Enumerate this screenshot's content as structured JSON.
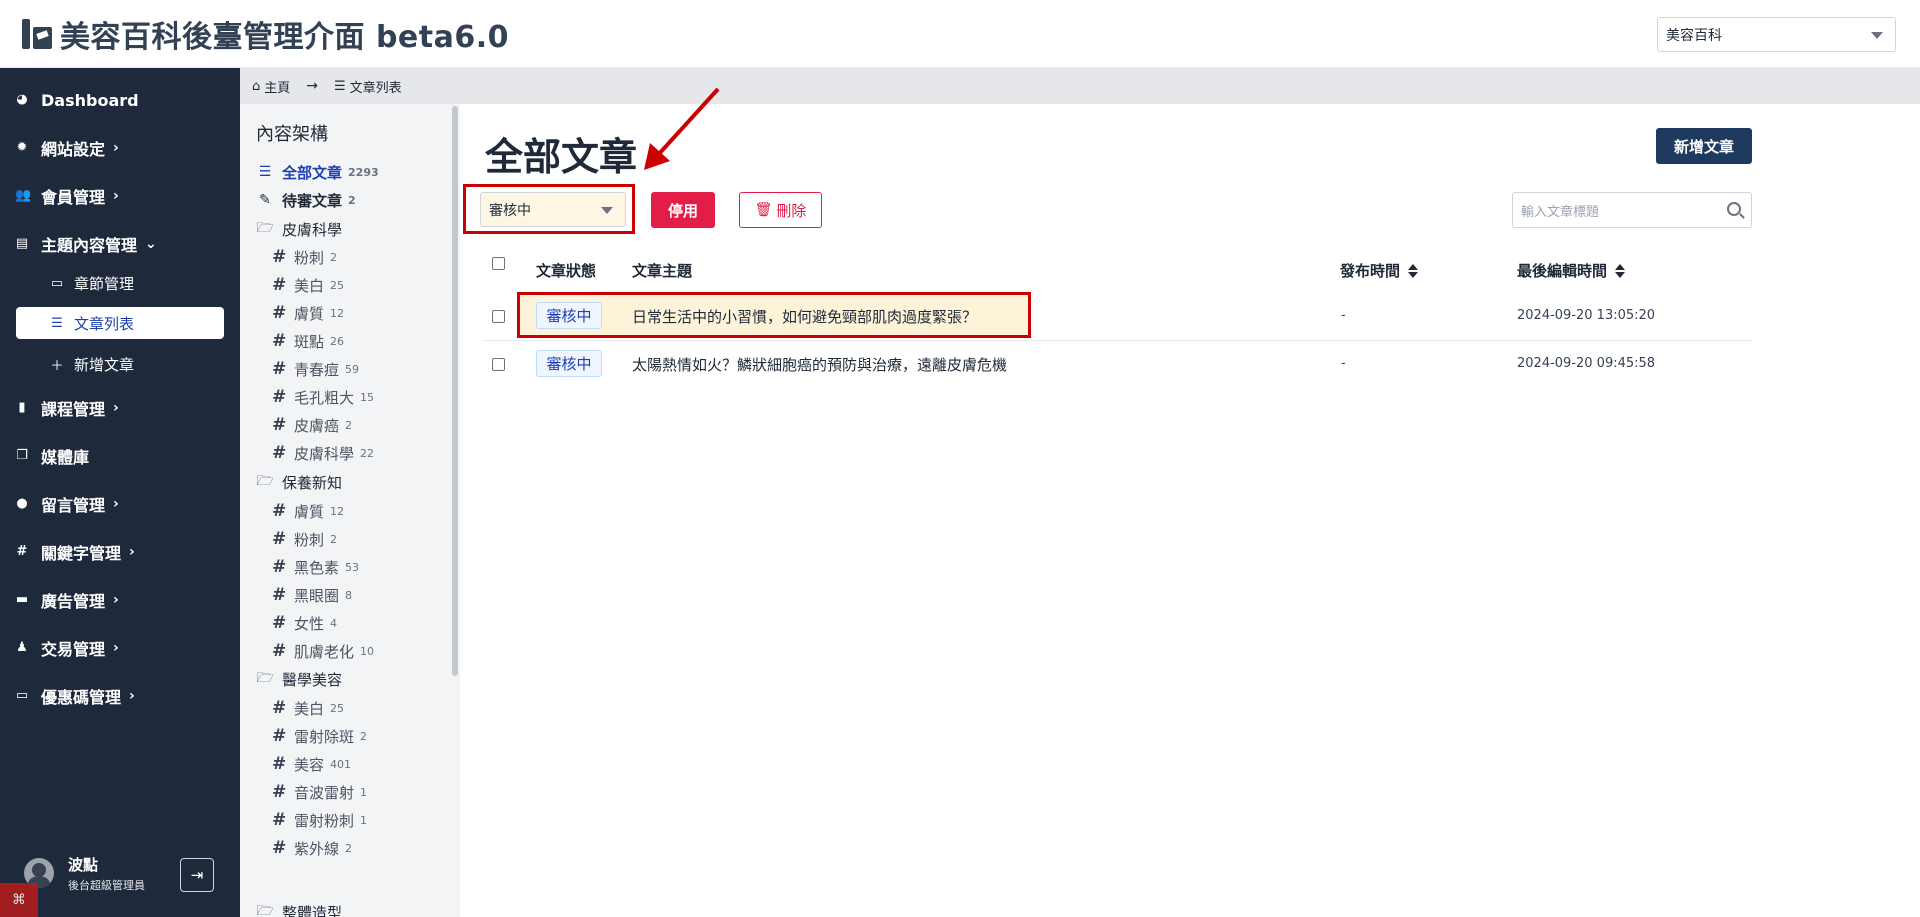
{
  "header": {
    "title": "美容百科後臺管理介面 beta6.0",
    "site_select": "美容百科"
  },
  "sidebar": {
    "items": [
      {
        "label": "Dashboard",
        "icon": "dashboard-icon",
        "chevron": ""
      },
      {
        "label": "網站設定",
        "icon": "gear-icon",
        "chevron": "›"
      },
      {
        "label": "會員管理",
        "icon": "users-icon",
        "chevron": "›"
      },
      {
        "label": "主題內容管理",
        "icon": "layout-icon",
        "chevron": "⌄"
      },
      {
        "label": "課程管理",
        "icon": "book-icon",
        "chevron": "›"
      },
      {
        "label": "媒體庫",
        "icon": "images-icon",
        "chevron": ""
      },
      {
        "label": "留言管理",
        "icon": "comment-icon",
        "chevron": "›"
      },
      {
        "label": "關鍵字管理",
        "icon": "hash-icon",
        "chevron": "›"
      },
      {
        "label": "廣告管理",
        "icon": "ad-icon",
        "chevron": "›"
      },
      {
        "label": "交易管理",
        "icon": "money-bag-icon",
        "chevron": "›"
      },
      {
        "label": "優惠碼管理",
        "icon": "ticket-icon",
        "chevron": "›"
      }
    ],
    "sub_items": [
      {
        "label": "章節管理",
        "icon": "chapters-icon"
      },
      {
        "label": "文章列表",
        "icon": "list-icon"
      },
      {
        "label": "新增文章",
        "icon": "plus-icon"
      }
    ],
    "user": {
      "name": "波點",
      "role": "後台超級管理員"
    }
  },
  "breadcrumb": {
    "home": "主頁",
    "current": "文章列表"
  },
  "tree": {
    "title": "內容架構",
    "all": {
      "label": "全部文章",
      "count": "2293"
    },
    "pending": {
      "label": "待審文章",
      "count": "2"
    },
    "categories": [
      {
        "name": "皮膚科學",
        "tags": [
          {
            "name": "粉刺",
            "count": "2"
          },
          {
            "name": "美白",
            "count": "25"
          },
          {
            "name": "膚質",
            "count": "12"
          },
          {
            "name": "斑點",
            "count": "26"
          },
          {
            "name": "青春痘",
            "count": "59"
          },
          {
            "name": "毛孔粗大",
            "count": "15"
          },
          {
            "name": "皮膚癌",
            "count": "2"
          },
          {
            "name": "皮膚科學",
            "count": "22"
          }
        ]
      },
      {
        "name": "保養新知",
        "tags": [
          {
            "name": "膚質",
            "count": "12"
          },
          {
            "name": "粉刺",
            "count": "2"
          },
          {
            "name": "黑色素",
            "count": "53"
          },
          {
            "name": "黑眼圈",
            "count": "8"
          },
          {
            "name": "女性",
            "count": "4"
          },
          {
            "name": "肌膚老化",
            "count": "10"
          }
        ]
      },
      {
        "name": "醫學美容",
        "tags": [
          {
            "name": "美白",
            "count": "25"
          },
          {
            "name": "雷射除斑",
            "count": "2"
          },
          {
            "name": "美容",
            "count": "401"
          },
          {
            "name": "音波雷射",
            "count": "1"
          },
          {
            "name": "雷射粉刺",
            "count": "1"
          },
          {
            "name": "紫外線",
            "count": "2"
          }
        ]
      },
      {
        "name": "整體造型",
        "tags": []
      }
    ]
  },
  "main": {
    "title": "全部文章",
    "new_button": "新增文章",
    "status_filter": "審核中",
    "disable_button": "停用",
    "delete_button": "刪除",
    "search_placeholder": "輸入文章標題",
    "columns": {
      "status": "文章狀態",
      "subject": "文章主題",
      "published": "發布時間",
      "edited": "最後編輯時間"
    },
    "rows": [
      {
        "status": "審核中",
        "subject": "日常生活中的小習慣，如何避免頸部肌肉過度緊張？",
        "published": "-",
        "edited": "2024-09-20 13:05:20"
      },
      {
        "status": "審核中",
        "subject": "太陽熱情如火？鱗狀細胞癌的預防與治療，遠離皮膚危機",
        "published": "-",
        "edited": "2024-09-20 09:45:58"
      }
    ]
  },
  "colors": {
    "sidebar_bg": "#1e293b",
    "accent_red": "#e11d48",
    "primary_dark": "#1e3a5f",
    "badge_blue": "#1e40af",
    "annotation_red": "#cc0000"
  }
}
